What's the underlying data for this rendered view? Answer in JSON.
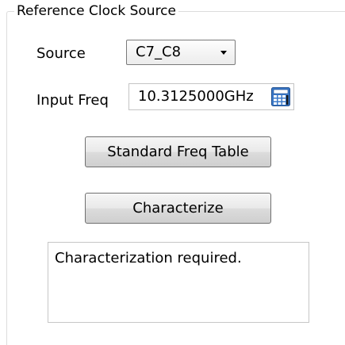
{
  "group": {
    "title": "Reference Clock Source"
  },
  "source": {
    "label": "Source",
    "selected": "C7_C8",
    "arrow_icon": "chevron-down-icon"
  },
  "input_freq": {
    "label": "Input Freq",
    "value": "10.3125000GHz",
    "calculator_icon": "calculator-icon"
  },
  "buttons": {
    "standard_freq_table": "Standard Freq Table",
    "characterize": "Characterize"
  },
  "status": {
    "message": "Characterization required."
  },
  "colors": {
    "calculator_blue": "#3a78c8",
    "border": "#707070"
  }
}
